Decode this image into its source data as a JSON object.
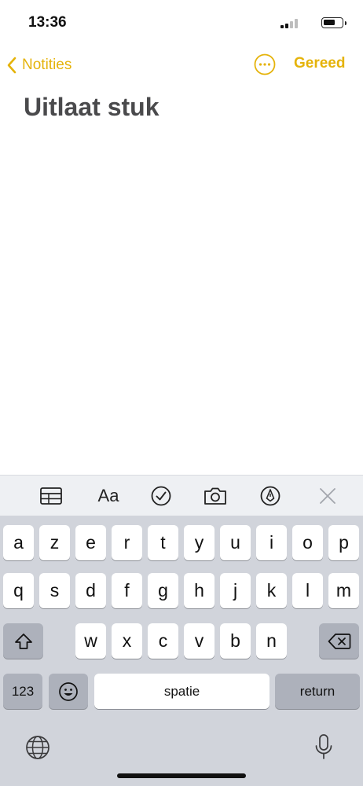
{
  "status_bar": {
    "time": "13:36",
    "signal_icon": "cellular-signal-icon",
    "battery_icon": "battery-icon"
  },
  "nav": {
    "back_label": "Notities",
    "more_icon": "ellipsis-circle-icon",
    "done_label": "Gereed",
    "accent_color": "#e5b30a"
  },
  "note": {
    "title": "Uitlaat stuk"
  },
  "toolbar": {
    "items": [
      {
        "name": "table-icon"
      },
      {
        "name": "text-format",
        "label": "Aa"
      },
      {
        "name": "checklist-icon"
      },
      {
        "name": "camera-icon"
      },
      {
        "name": "markup-pen-icon"
      },
      {
        "name": "close-keyboard-icon"
      }
    ]
  },
  "keyboard": {
    "row1": [
      "a",
      "z",
      "e",
      "r",
      "t",
      "y",
      "u",
      "i",
      "o",
      "p"
    ],
    "row2": [
      "q",
      "s",
      "d",
      "f",
      "g",
      "h",
      "j",
      "k",
      "l",
      "m"
    ],
    "row3": [
      "w",
      "x",
      "c",
      "v",
      "b",
      "n"
    ],
    "numbers_label": "123",
    "space_label": "spatie",
    "return_label": "return",
    "shift_icon": "shift-icon",
    "backspace_icon": "backspace-icon",
    "emoji_icon": "emoji-icon",
    "globe_icon": "globe-icon",
    "mic_icon": "microphone-icon"
  }
}
